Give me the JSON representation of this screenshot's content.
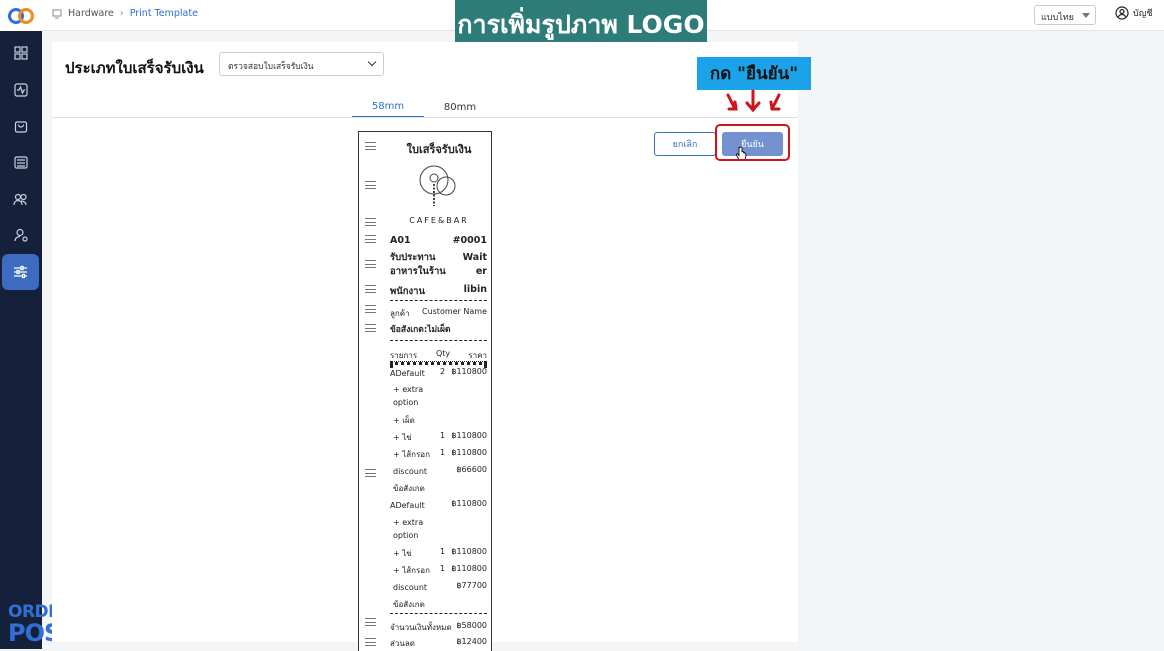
{
  "header": {
    "breadcrumb": [
      "Hardware",
      "Print Template"
    ],
    "language": "แบบไทย",
    "account": "บัญชี"
  },
  "banner": "การเพิ่มรูปภาพ LOGO",
  "callout": "กด \"ยืนยัน\"",
  "brand": {
    "line1": "ORDER",
    "line2": "POS"
  },
  "page": {
    "title": "ประเภทใบเสร็จรับเงิน",
    "select_value": "ตรวจสอบใบเสร็จรับเงิน",
    "tabs": [
      "58mm",
      "80mm"
    ],
    "active_tab": "58mm",
    "cancel_label": "ยกเลิก",
    "confirm_label": "ยืนยัน"
  },
  "colors": {
    "sidebar": "#15213b",
    "accent": "#2f6fd6",
    "banner": "#2e7c79",
    "callout": "#1aa3e8",
    "highlight": "#d0121b"
  },
  "sidebar": [
    "grid-icon",
    "pulse-icon",
    "bag-icon",
    "archive-icon",
    "users-icon",
    "user-settings-icon",
    "sliders-icon"
  ],
  "receipt": {
    "title": "ใบเสร็จรับเงิน",
    "logo_text": "CAFE&BAR",
    "table": "A01",
    "order_no": "#0001",
    "service_label": "รับประทาน\nอาหารในร้าน",
    "service_value": "Wait\ner",
    "staff_label": "พนักงาน",
    "staff_value": "libin",
    "customer_label": "ลูกค้า",
    "customer_value": "Customer Name",
    "note": "ข้อสังเกต:ไม่เผ็ด",
    "col_item": "รายการ",
    "col_qty": "Qty",
    "col_price": "ราคา",
    "items": [
      {
        "name": "ADefault",
        "qty": "2",
        "price": "฿110800"
      },
      {
        "name": "+ extra\noption",
        "qty": "",
        "price": ""
      },
      {
        "name": "+ เผ็ด",
        "qty": "",
        "price": ""
      },
      {
        "name": "+ ไข่",
        "qty": "1",
        "price": "฿110800"
      },
      {
        "name": "+ ไส้กรอก",
        "qty": "1",
        "price": "฿110800"
      },
      {
        "name": "discount",
        "qty": "",
        "price": "฿66600"
      },
      {
        "name": "ข้อสังเกต",
        "qty": "",
        "price": ""
      },
      {
        "name": "ADefault",
        "qty": "",
        "price": "฿110800"
      },
      {
        "name": "+ extra\noption",
        "qty": "",
        "price": ""
      },
      {
        "name": "+ ไข่",
        "qty": "1",
        "price": "฿110800"
      },
      {
        "name": "+ ไส้กรอก",
        "qty": "1",
        "price": "฿110800"
      },
      {
        "name": "discount",
        "qty": "",
        "price": "฿77700"
      },
      {
        "name": "ข้อสังเกต",
        "qty": "",
        "price": ""
      }
    ],
    "total_label": "จำนวนเงินทั้งหมด",
    "total_value": "฿58000",
    "discount_label": "ส่วนลด",
    "discount_value": "฿12400"
  }
}
